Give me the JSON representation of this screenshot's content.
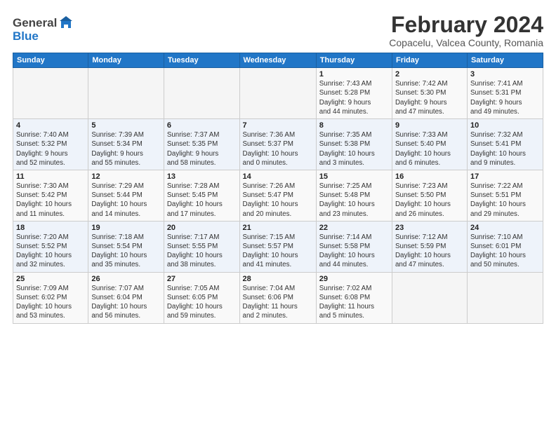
{
  "header": {
    "logo_line1": "General",
    "logo_line2": "Blue",
    "main_title": "February 2024",
    "sub_title": "Copacelu, Valcea County, Romania"
  },
  "calendar": {
    "days_of_week": [
      "Sunday",
      "Monday",
      "Tuesday",
      "Wednesday",
      "Thursday",
      "Friday",
      "Saturday"
    ],
    "weeks": [
      [
        {
          "day": "",
          "info": ""
        },
        {
          "day": "",
          "info": ""
        },
        {
          "day": "",
          "info": ""
        },
        {
          "day": "",
          "info": ""
        },
        {
          "day": "1",
          "info": "Sunrise: 7:43 AM\nSunset: 5:28 PM\nDaylight: 9 hours\nand 44 minutes."
        },
        {
          "day": "2",
          "info": "Sunrise: 7:42 AM\nSunset: 5:30 PM\nDaylight: 9 hours\nand 47 minutes."
        },
        {
          "day": "3",
          "info": "Sunrise: 7:41 AM\nSunset: 5:31 PM\nDaylight: 9 hours\nand 49 minutes."
        }
      ],
      [
        {
          "day": "4",
          "info": "Sunrise: 7:40 AM\nSunset: 5:32 PM\nDaylight: 9 hours\nand 52 minutes."
        },
        {
          "day": "5",
          "info": "Sunrise: 7:39 AM\nSunset: 5:34 PM\nDaylight: 9 hours\nand 55 minutes."
        },
        {
          "day": "6",
          "info": "Sunrise: 7:37 AM\nSunset: 5:35 PM\nDaylight: 9 hours\nand 58 minutes."
        },
        {
          "day": "7",
          "info": "Sunrise: 7:36 AM\nSunset: 5:37 PM\nDaylight: 10 hours\nand 0 minutes."
        },
        {
          "day": "8",
          "info": "Sunrise: 7:35 AM\nSunset: 5:38 PM\nDaylight: 10 hours\nand 3 minutes."
        },
        {
          "day": "9",
          "info": "Sunrise: 7:33 AM\nSunset: 5:40 PM\nDaylight: 10 hours\nand 6 minutes."
        },
        {
          "day": "10",
          "info": "Sunrise: 7:32 AM\nSunset: 5:41 PM\nDaylight: 10 hours\nand 9 minutes."
        }
      ],
      [
        {
          "day": "11",
          "info": "Sunrise: 7:30 AM\nSunset: 5:42 PM\nDaylight: 10 hours\nand 11 minutes."
        },
        {
          "day": "12",
          "info": "Sunrise: 7:29 AM\nSunset: 5:44 PM\nDaylight: 10 hours\nand 14 minutes."
        },
        {
          "day": "13",
          "info": "Sunrise: 7:28 AM\nSunset: 5:45 PM\nDaylight: 10 hours\nand 17 minutes."
        },
        {
          "day": "14",
          "info": "Sunrise: 7:26 AM\nSunset: 5:47 PM\nDaylight: 10 hours\nand 20 minutes."
        },
        {
          "day": "15",
          "info": "Sunrise: 7:25 AM\nSunset: 5:48 PM\nDaylight: 10 hours\nand 23 minutes."
        },
        {
          "day": "16",
          "info": "Sunrise: 7:23 AM\nSunset: 5:50 PM\nDaylight: 10 hours\nand 26 minutes."
        },
        {
          "day": "17",
          "info": "Sunrise: 7:22 AM\nSunset: 5:51 PM\nDaylight: 10 hours\nand 29 minutes."
        }
      ],
      [
        {
          "day": "18",
          "info": "Sunrise: 7:20 AM\nSunset: 5:52 PM\nDaylight: 10 hours\nand 32 minutes."
        },
        {
          "day": "19",
          "info": "Sunrise: 7:18 AM\nSunset: 5:54 PM\nDaylight: 10 hours\nand 35 minutes."
        },
        {
          "day": "20",
          "info": "Sunrise: 7:17 AM\nSunset: 5:55 PM\nDaylight: 10 hours\nand 38 minutes."
        },
        {
          "day": "21",
          "info": "Sunrise: 7:15 AM\nSunset: 5:57 PM\nDaylight: 10 hours\nand 41 minutes."
        },
        {
          "day": "22",
          "info": "Sunrise: 7:14 AM\nSunset: 5:58 PM\nDaylight: 10 hours\nand 44 minutes."
        },
        {
          "day": "23",
          "info": "Sunrise: 7:12 AM\nSunset: 5:59 PM\nDaylight: 10 hours\nand 47 minutes."
        },
        {
          "day": "24",
          "info": "Sunrise: 7:10 AM\nSunset: 6:01 PM\nDaylight: 10 hours\nand 50 minutes."
        }
      ],
      [
        {
          "day": "25",
          "info": "Sunrise: 7:09 AM\nSunset: 6:02 PM\nDaylight: 10 hours\nand 53 minutes."
        },
        {
          "day": "26",
          "info": "Sunrise: 7:07 AM\nSunset: 6:04 PM\nDaylight: 10 hours\nand 56 minutes."
        },
        {
          "day": "27",
          "info": "Sunrise: 7:05 AM\nSunset: 6:05 PM\nDaylight: 10 hours\nand 59 minutes."
        },
        {
          "day": "28",
          "info": "Sunrise: 7:04 AM\nSunset: 6:06 PM\nDaylight: 11 hours\nand 2 minutes."
        },
        {
          "day": "29",
          "info": "Sunrise: 7:02 AM\nSunset: 6:08 PM\nDaylight: 11 hours\nand 5 minutes."
        },
        {
          "day": "",
          "info": ""
        },
        {
          "day": "",
          "info": ""
        }
      ]
    ]
  }
}
